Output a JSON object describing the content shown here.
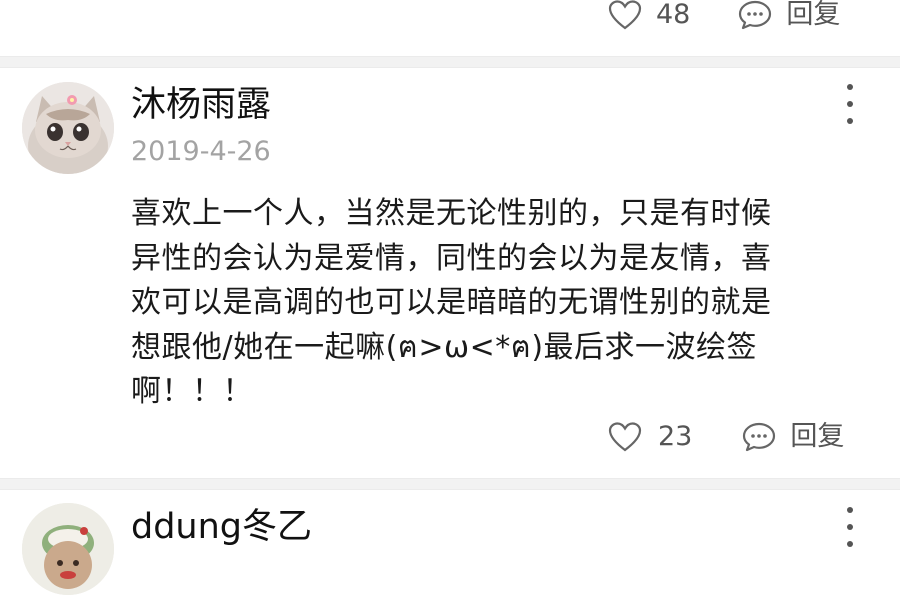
{
  "previous_comment": {
    "like_count": "48",
    "reply_label": "回复"
  },
  "comment": {
    "username": "沐杨雨露",
    "date": "2019-4-26",
    "text_lines": [
      "喜欢上一个人，当然是无论性别的，只是有时候",
      "异性的会认为是爱情，同性的会以为是友情，喜",
      "欢可以是高调的也可以是暗暗的无谓性别的就是",
      "想跟他/她在一起嘛(ฅ>ω<*ฅ)最后求一波绘签",
      "啊！！！"
    ],
    "like_count": "23",
    "reply_label": "回复"
  },
  "next_comment": {
    "username": "ddung冬乙"
  },
  "icons": {
    "like": "heart-outline-icon",
    "reply": "speech-bubble-icon",
    "more": "vertical-ellipsis-icon"
  },
  "colors": {
    "text": "#1a1a1a",
    "secondary": "#a3a3a3",
    "icon": "#555555",
    "separator": "#f2f2f2"
  }
}
